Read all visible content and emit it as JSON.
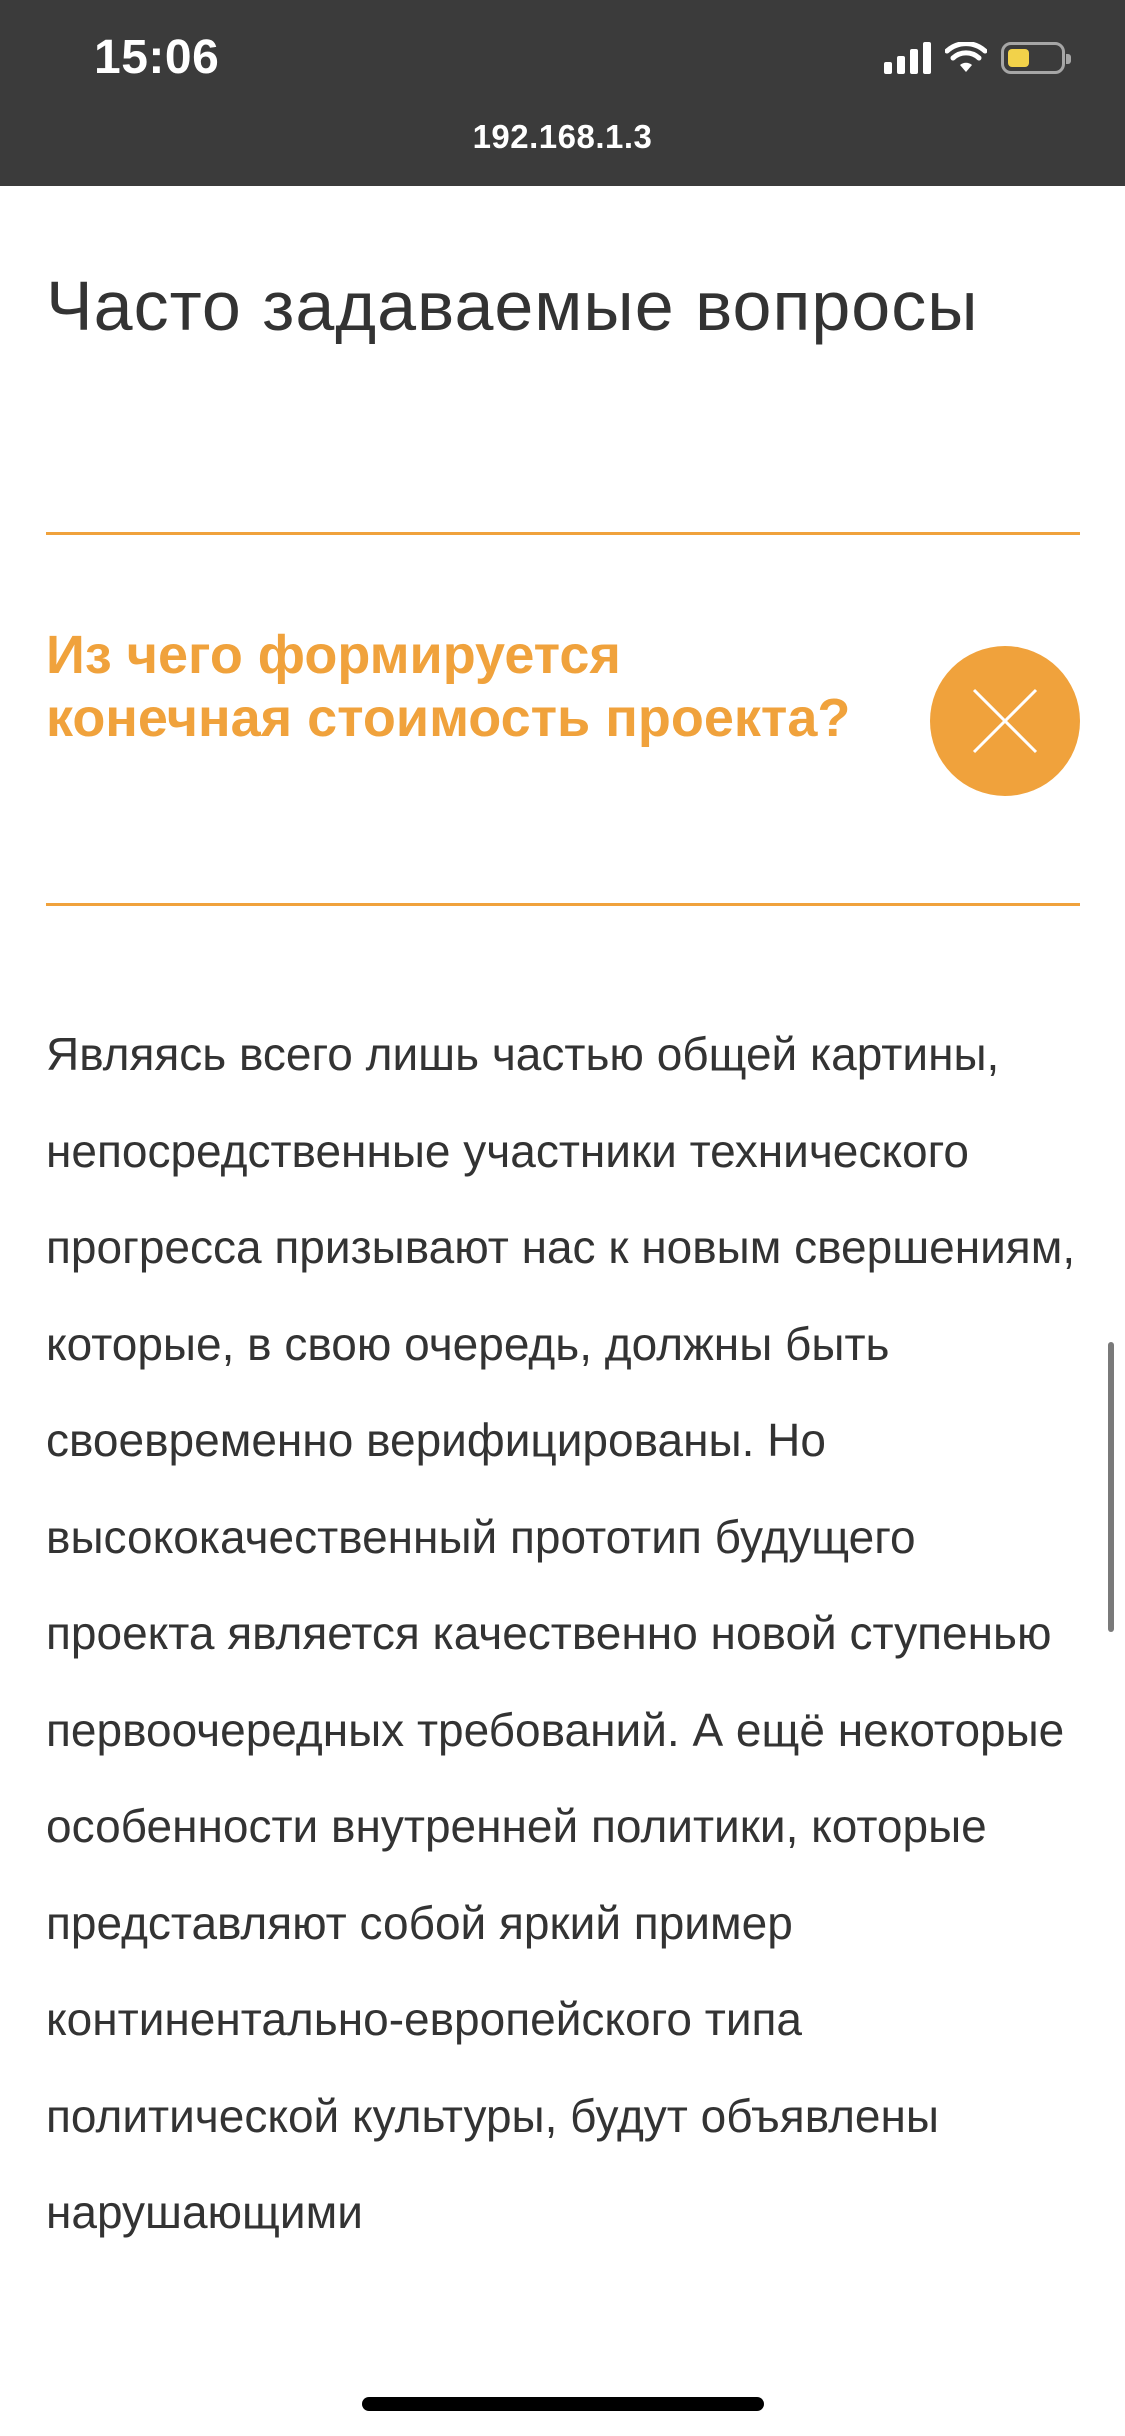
{
  "status_bar": {
    "time": "15:06",
    "signal_icon": "cellular-signal-icon",
    "wifi_icon": "wifi-icon",
    "battery_icon": "battery-icon",
    "battery_level": 0.4,
    "battery_color": "#f2d24a"
  },
  "address_bar": {
    "url": "192.168.1.3"
  },
  "page": {
    "title": "Часто задаваемые вопросы",
    "accent_color": "#f0a23c",
    "faq": {
      "question": "Из чего формируется конечная стоимость проекта?",
      "close_icon": "close-icon",
      "answer": "Являясь всего лишь частью общей картины, непосредственные участники технического прогресса призывают нас к новым свершениям, которые, в свою очередь, должны быть своевременно верифицированы. Но высококачественный прототип будущего проекта является качественно новой ступенью первоочередных требований. А ещё некоторые особенности внутренней политики, которые представляют собой яркий пример континентально-европейского типа политической культуры, будут объявлены нарушающими"
    }
  }
}
